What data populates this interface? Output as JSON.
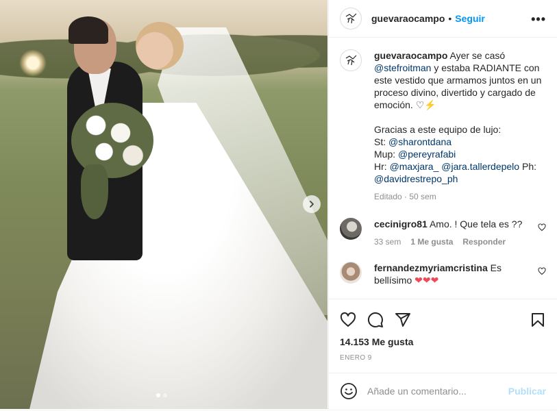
{
  "post": {
    "author": "guevaraocampo",
    "separator": "•",
    "follow_label": "Seguir",
    "more_label": "•••",
    "caption": {
      "text_1": " Ayer se casó ",
      "mention_1": "@stefroitman",
      "text_2": " y estaba RADIANTE con este vestido que armamos juntos en un proceso divino, divertido y cargado de emoción. ♡⚡",
      "text_3": "Gracias a este equipo de lujo:",
      "line_st_label": "St: ",
      "line_st": "@sharontdana",
      "line_mup_label": "Mup: ",
      "line_mup": "@pereyrafabi",
      "line_hr_label": "Hr: ",
      "line_hr_1": "@maxjara_",
      "line_hr_2": "@jara.tallerdepelo",
      "line_ph_label": " Ph:",
      "line_ph": "@davidrestrepo_ph",
      "meta": "Editado · 50 sem"
    },
    "comments": [
      {
        "user": "cecinigro81",
        "text": " Amo. ! Que tela es ??",
        "age": "33 sem",
        "likes": "1 Me gusta",
        "reply": "Responder"
      },
      {
        "user": "fernandezmyriamcristina",
        "text_1": " Es",
        "text_2": "bellísimo ",
        "hearts": "❤❤❤"
      }
    ],
    "likes": "14.153 Me gusta",
    "date": "ENERO 9",
    "comment_placeholder": "Añade un comentario...",
    "publish_label": "Publicar",
    "carousel": {
      "slides": 2,
      "active": 1
    }
  }
}
